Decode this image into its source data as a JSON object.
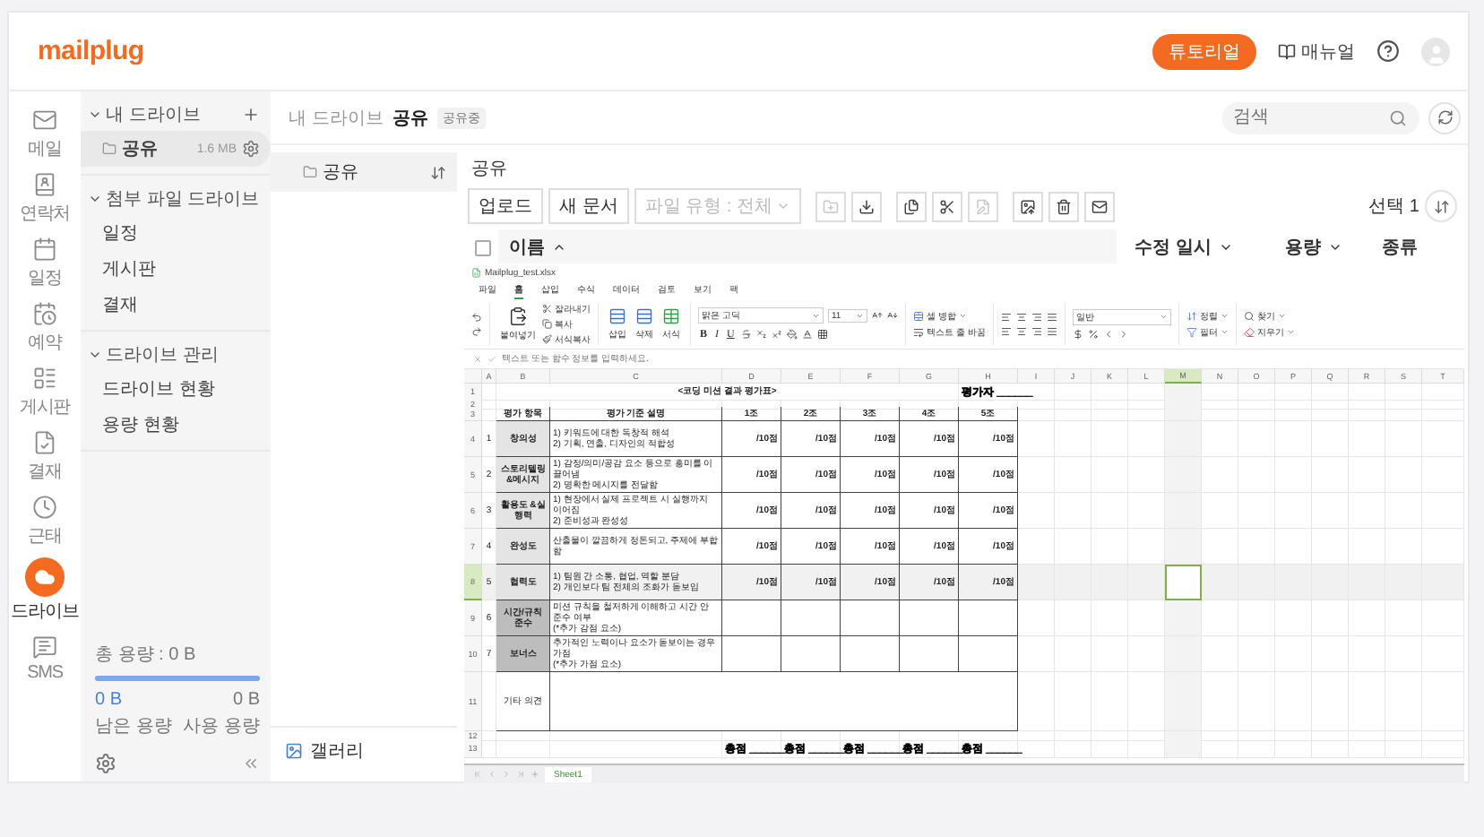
{
  "header": {
    "logo": "mailplug",
    "tutorial_button": "튜토리얼",
    "manual_link": "매뉴얼"
  },
  "rail": [
    {
      "label": "메일",
      "selected": false
    },
    {
      "label": "연락처",
      "selected": false
    },
    {
      "label": "일정",
      "selected": false
    },
    {
      "label": "예약",
      "selected": false
    },
    {
      "label": "게시판",
      "selected": false
    },
    {
      "label": "결재",
      "selected": false
    },
    {
      "label": "근태",
      "selected": false
    },
    {
      "label": "드라이브",
      "selected": true
    },
    {
      "label": "SMS",
      "selected": false
    }
  ],
  "sidebar": {
    "sections": [
      {
        "title": "내 드라이브",
        "expanded": true,
        "items": [
          {
            "label": "공유",
            "size": "1.6 MB",
            "selected": true
          }
        ]
      },
      {
        "title": "첨부 파일 드라이브",
        "expanded": true,
        "items": [
          {
            "label": "일정",
            "selected": false
          },
          {
            "label": "게시판",
            "selected": false
          },
          {
            "label": "결재",
            "selected": false
          }
        ]
      },
      {
        "title": "드라이브 관리",
        "expanded": true,
        "items": [
          {
            "label": "드라이브 현황",
            "selected": false
          },
          {
            "label": "용량 현황",
            "selected": false
          }
        ]
      }
    ],
    "storage": {
      "total": "총 용량 : 0 B",
      "level": 1,
      "remaining_value": "0 B",
      "used_value": "0 B",
      "remaining_label": "남은 용량",
      "used_label": "사용 용량"
    }
  },
  "breadcrumb": {
    "parent": "내 드라이브",
    "current": "공유",
    "badge": "공유중"
  },
  "search": {
    "placeholder": "검색"
  },
  "tree": {
    "items": [
      {
        "label": "공유",
        "selected": true
      }
    ],
    "footer": "갤러리"
  },
  "content": {
    "title": "공유",
    "buttons": [
      "업로드",
      "새 문서"
    ],
    "filter": {
      "label": "파일 유형 : 전체",
      "disabled": true
    },
    "icon_buttons": [
      {
        "disabled": true
      },
      {
        "disabled": false
      },
      {
        "disabled": false
      },
      {
        "disabled": false
      },
      {
        "disabled": true
      },
      {
        "disabled": false
      },
      {
        "disabled": false
      },
      {
        "disabled": false
      }
    ],
    "selection": "선택 1",
    "select_all": {
      "checked": false
    },
    "columns": [
      {
        "label": "이름",
        "sorted": true,
        "menu": false
      },
      {
        "label": "수정 일시",
        "sorted": false,
        "menu": true
      },
      {
        "label": "용량",
        "sorted": false,
        "menu": true
      },
      {
        "label": "종류",
        "sorted": false,
        "menu": false
      }
    ]
  },
  "viewer": {
    "file_name": "Mailplug_test.xlsx",
    "menu": [
      {
        "label": "파일",
        "selected": false
      },
      {
        "label": "홈",
        "selected": true
      },
      {
        "label": "삽입",
        "selected": false
      },
      {
        "label": "수식",
        "selected": false
      },
      {
        "label": "데이터",
        "selected": false
      },
      {
        "label": "검토",
        "selected": false
      },
      {
        "label": "보기",
        "selected": false
      },
      {
        "label": "팩",
        "selected": false
      }
    ],
    "ribbon": {
      "paste": "붙여넣기",
      "cut": "잘라내기",
      "copy": "복사",
      "format_painter": "서식복사",
      "insert": "삽입",
      "delete": "삭제",
      "format": "서식",
      "font": "맑은 고딕",
      "font_size": "11",
      "bold": "B",
      "italic": "I",
      "underline": "U",
      "merge": "셀 병합",
      "wrap": "텍스트 줄 바꿈",
      "number_format": "일반",
      "sort": "정렬",
      "filter": "필터",
      "find": "찾기",
      "clear": "지우기"
    },
    "formula_placeholder": "텍스트 또는 함수 정보를 입력하세요.",
    "columns": [
      {
        "label": "A",
        "selected": false
      },
      {
        "label": "B",
        "selected": false
      },
      {
        "label": "C",
        "selected": false
      },
      {
        "label": "D",
        "selected": false
      },
      {
        "label": "E",
        "selected": false
      },
      {
        "label": "F",
        "selected": false
      },
      {
        "label": "G",
        "selected": false
      },
      {
        "label": "H",
        "selected": false
      },
      {
        "label": "I",
        "selected": false
      },
      {
        "label": "J",
        "selected": false
      },
      {
        "label": "K",
        "selected": false
      },
      {
        "label": "L",
        "selected": false
      },
      {
        "label": "M",
        "selected": true
      },
      {
        "label": "N",
        "selected": false
      },
      {
        "label": "O",
        "selected": false
      },
      {
        "label": "P",
        "selected": false
      },
      {
        "label": "Q",
        "selected": false
      },
      {
        "label": "R",
        "selected": false
      },
      {
        "label": "S",
        "selected": false
      },
      {
        "label": "T",
        "selected": false
      }
    ],
    "rows": [
      {
        "number": "1",
        "kind": "title",
        "title": "<코딩 미션 결과 평가표>",
        "evaluator": "평가자 ______",
        "selected": false
      },
      {
        "number": "2",
        "kind": "blank",
        "selected": false
      },
      {
        "number": "3",
        "kind": "header",
        "cells": [
          "평가 항목",
          "평가 기준 설명",
          "1조",
          "2조",
          "3조",
          "4조",
          "5조"
        ],
        "selected": false
      },
      {
        "number": "4",
        "kind": "criterion",
        "index": "1",
        "item": "창의성",
        "color": "#e4e4e4",
        "lines": [
          "1) 키워드에 대한 독창적 해석",
          "2) 기획, 연출, 디자인의 적합성"
        ],
        "scores": [
          "/10점",
          "/10점",
          "/10점",
          "/10점",
          "/10점"
        ],
        "selected": false
      },
      {
        "number": "5",
        "kind": "criterion",
        "index": "2",
        "item": "스토리텔링 &메시지",
        "color": "#e4e4e4",
        "lines": [
          "1) 감정/의미/공감 요소 등으로 흥미를 이끌어냄",
          "2) 명확한 메시지를 전달함"
        ],
        "scores": [
          "/10점",
          "/10점",
          "/10점",
          "/10점",
          "/10점"
        ],
        "selected": false
      },
      {
        "number": "6",
        "kind": "criterion",
        "index": "3",
        "item": "활용도 &실행력",
        "color": "#e4e4e4",
        "lines": [
          "1) 현장에서 실제 프로젝트 시 실행까지 이어짐",
          "2) 준비성과 완성성"
        ],
        "scores": [
          "/10점",
          "/10점",
          "/10점",
          "/10점",
          "/10점"
        ],
        "selected": false
      },
      {
        "number": "7",
        "kind": "criterion",
        "index": "4",
        "item": "완성도",
        "color": "#e4e4e4",
        "lines": [
          "산출물이 깔끔하게 정돈되고, 주제에 부합함"
        ],
        "scores": [
          "/10점",
          "/10점",
          "/10점",
          "/10점",
          "/10점"
        ],
        "selected": false
      },
      {
        "number": "8",
        "kind": "criterion",
        "index": "5",
        "item": "협력도",
        "color": "#e4e4e4",
        "lines": [
          "1) 팀원 간 소통, 협업, 역할 분담",
          "2) 개인보다 팀 전체의 조화가 돋보임"
        ],
        "scores": [
          "/10점",
          "/10점",
          "/10점",
          "/10점",
          "/10점"
        ],
        "selected": true
      },
      {
        "number": "9",
        "kind": "criterion",
        "index": "6",
        "item": "시간/규칙 준수",
        "color": "#bdbdbd",
        "lines": [
          "미션 규칙을 철저하게 이해하고 시간 안 준수 여부",
          "(*추가 감점 요소)"
        ],
        "selected": false
      },
      {
        "number": "10",
        "kind": "criterion",
        "index": "7",
        "item": "보너스",
        "color": "#bdbdbd",
        "lines": [
          "추가적인 노력이나 요소가 돋보이는 경우 가점",
          "(*추가 가점 요소)"
        ],
        "selected": false
      },
      {
        "number": "11",
        "kind": "opinion",
        "label": "기타 의견",
        "selected": false
      },
      {
        "number": "12",
        "kind": "blank",
        "selected": false
      },
      {
        "number": "13",
        "kind": "total",
        "totals": [
          "총점 ______",
          "총점 ______",
          "총점 ______",
          "총점 ______",
          "총점 ______"
        ],
        "selected": false
      }
    ],
    "sheet_tabs": [
      {
        "label": "Sheet1",
        "selected": true
      }
    ]
  }
}
